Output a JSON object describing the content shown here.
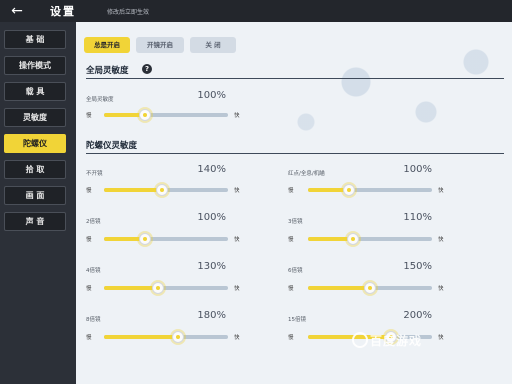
{
  "header": {
    "back_icon": "←",
    "title": "设置",
    "save_hint": "修改后立即生效"
  },
  "sidebar": {
    "items": [
      {
        "label": "基 础",
        "active": false
      },
      {
        "label": "操作模式",
        "active": false
      },
      {
        "label": "载 具",
        "active": false
      },
      {
        "label": "灵敏度",
        "active": false
      },
      {
        "label": "陀螺仪",
        "active": true
      },
      {
        "label": "拾 取",
        "active": false
      },
      {
        "label": "画 面",
        "active": false
      },
      {
        "label": "声 音",
        "active": false
      }
    ]
  },
  "mode_buttons": [
    {
      "label": "总是开启",
      "active": true
    },
    {
      "label": "开镜开启",
      "active": false
    },
    {
      "label": "关 闭",
      "active": false
    }
  ],
  "global_section": {
    "title": "全局灵敏度",
    "help_icon": "?",
    "slider": {
      "label": "全局灵敏度",
      "value_text": "100%",
      "value": 100,
      "slow": "慢",
      "fast": "快"
    }
  },
  "gyro_section": {
    "title": "陀螺仪灵敏度",
    "sliders": [
      {
        "label": "不开镜",
        "value_text": "140%",
        "value": 140,
        "slow": "慢",
        "fast": "快"
      },
      {
        "label": "红点/全息/机瞄",
        "value_text": "100%",
        "value": 100,
        "slow": "慢",
        "fast": "快"
      },
      {
        "label": "2倍镜",
        "value_text": "100%",
        "value": 100,
        "slow": "慢",
        "fast": "快"
      },
      {
        "label": "3倍镜",
        "value_text": "110%",
        "value": 110,
        "slow": "慢",
        "fast": "快"
      },
      {
        "label": "4倍镜",
        "value_text": "130%",
        "value": 130,
        "slow": "慢",
        "fast": "快"
      },
      {
        "label": "6倍镜",
        "value_text": "150%",
        "value": 150,
        "slow": "慢",
        "fast": "快"
      },
      {
        "label": "8倍镜",
        "value_text": "180%",
        "value": 180,
        "slow": "慢",
        "fast": "快"
      },
      {
        "label": "15倍镜",
        "value_text": "200%",
        "value": 200,
        "slow": "慢",
        "fast": "快"
      }
    ]
  },
  "slider_range": {
    "min": 0,
    "max": 300
  },
  "watermark": {
    "icon": "baidu-games-logo-icon",
    "text": "百度游戏"
  },
  "colors": {
    "accent": "#f1d437",
    "sidebar_bg": "#1f2227",
    "panel_bg": "#eef2f6"
  }
}
